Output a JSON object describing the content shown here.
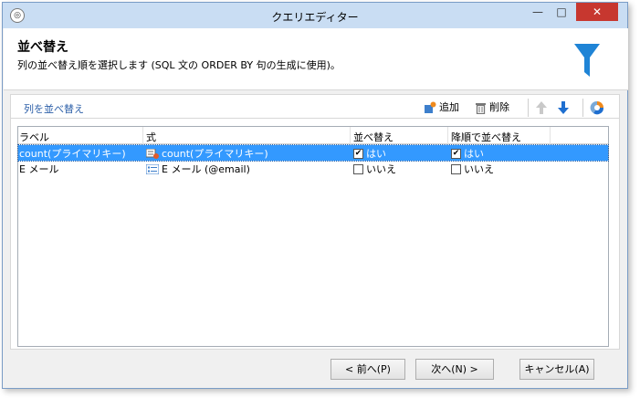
{
  "window": {
    "title": "クエリエディター",
    "controls": {
      "minimize": "—",
      "maximize": "□",
      "close": "✕"
    }
  },
  "header": {
    "title": "並べ替え",
    "subtitle": "列の並べ替え順を選択します (SQL 文の ORDER BY 句の生成に使用)。",
    "icon": "funnel-icon",
    "accent_color": "#1f84d6"
  },
  "toolbar": {
    "title": "列を並べ替え",
    "add_label": "追加",
    "delete_label": "削除"
  },
  "grid": {
    "columns": [
      "ラベル",
      "式",
      "並べ替え",
      "降順で並べ替え"
    ],
    "rows": [
      {
        "label": "count(プライマリキー)",
        "expression": "count(プライマリキー)",
        "sort": "はい",
        "sort_checked": true,
        "desc": "はい",
        "desc_checked": true,
        "selected": true
      },
      {
        "label": "E メール",
        "expression": "E メール (@email)",
        "sort": "いいえ",
        "sort_checked": false,
        "desc": "いいえ",
        "desc_checked": false,
        "selected": false
      }
    ]
  },
  "footer": {
    "prev_label": "< 前へ(P)",
    "next_label": "次へ(N) >",
    "cancel_label": "キャンセル(A)"
  }
}
